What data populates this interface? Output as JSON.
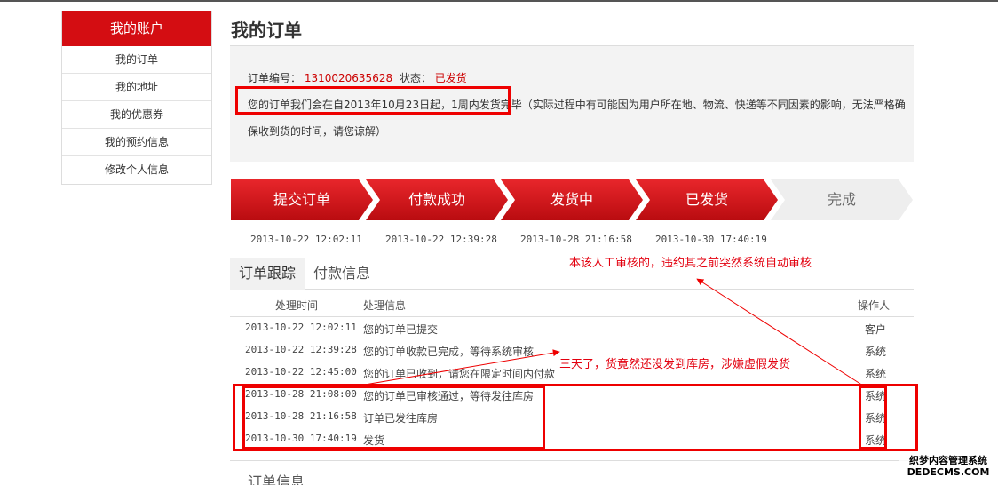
{
  "sidebar": {
    "header": "我的账户",
    "items": [
      {
        "label": "我的订单"
      },
      {
        "label": "我的地址"
      },
      {
        "label": "我的优惠券"
      },
      {
        "label": "我的预约信息"
      },
      {
        "label": "修改个人信息"
      }
    ]
  },
  "page": {
    "title": "我的订单"
  },
  "order": {
    "number_label": "订单编号：",
    "number": "1310020635628",
    "status_label": "状态：",
    "status": "已发货",
    "notice_line1": "您的订单我们会在自2013年10月23日起，1周内发货完毕（实际过程中有可能因为用户所在地、物流、快递等不同因素的影响，无法严格确",
    "notice_line2": "保收到货的时间，请您谅解）"
  },
  "steps": [
    {
      "label": "提交订单",
      "time": "2013-10-22 12:02:11",
      "done": true
    },
    {
      "label": "付款成功",
      "time": "2013-10-22 12:39:28",
      "done": true
    },
    {
      "label": "发货中",
      "time": "2013-10-28 21:16:58",
      "done": true
    },
    {
      "label": "已发货",
      "time": "2013-10-30 17:40:19",
      "done": true
    },
    {
      "label": "完成",
      "time": "",
      "done": false
    }
  ],
  "annotations": {
    "top": "本该人工审核的，违约其之前突然系统自动审核",
    "middle": "三天了，货竟然还没发到库房，涉嫌虚假发货"
  },
  "tabs": [
    {
      "label": "订单跟踪",
      "active": true
    },
    {
      "label": "付款信息",
      "active": false
    }
  ],
  "tracking": {
    "headers": {
      "time": "处理时间",
      "info": "处理信息",
      "operator": "操作人"
    },
    "rows": [
      {
        "time": "2013-10-22 12:02:11",
        "info": "您的订单已提交",
        "operator": "客户"
      },
      {
        "time": "2013-10-22 12:39:28",
        "info": "您的订单收款已完成，等待系统审核",
        "operator": "系统"
      },
      {
        "time": "2013-10-22 12:45:00",
        "info": "您的订单已收到，请您在限定时间内付款",
        "operator": "系统"
      },
      {
        "time": "2013-10-28 21:08:00",
        "info": "您的订单已审核通过，等待发往库房",
        "operator": "系统"
      },
      {
        "time": "2013-10-28 21:16:58",
        "info": "订单已发往库房",
        "operator": "系统"
      },
      {
        "time": "2013-10-30 17:40:19",
        "info": "发货",
        "operator": "系统"
      }
    ]
  },
  "section": {
    "order_info": "订单信息"
  },
  "watermark": {
    "line1": "织梦内容管理系统",
    "line2": "DEDECMS.COM"
  },
  "colors": {
    "brand_red": "#d40d12",
    "annotation_red": "#e3000f"
  }
}
